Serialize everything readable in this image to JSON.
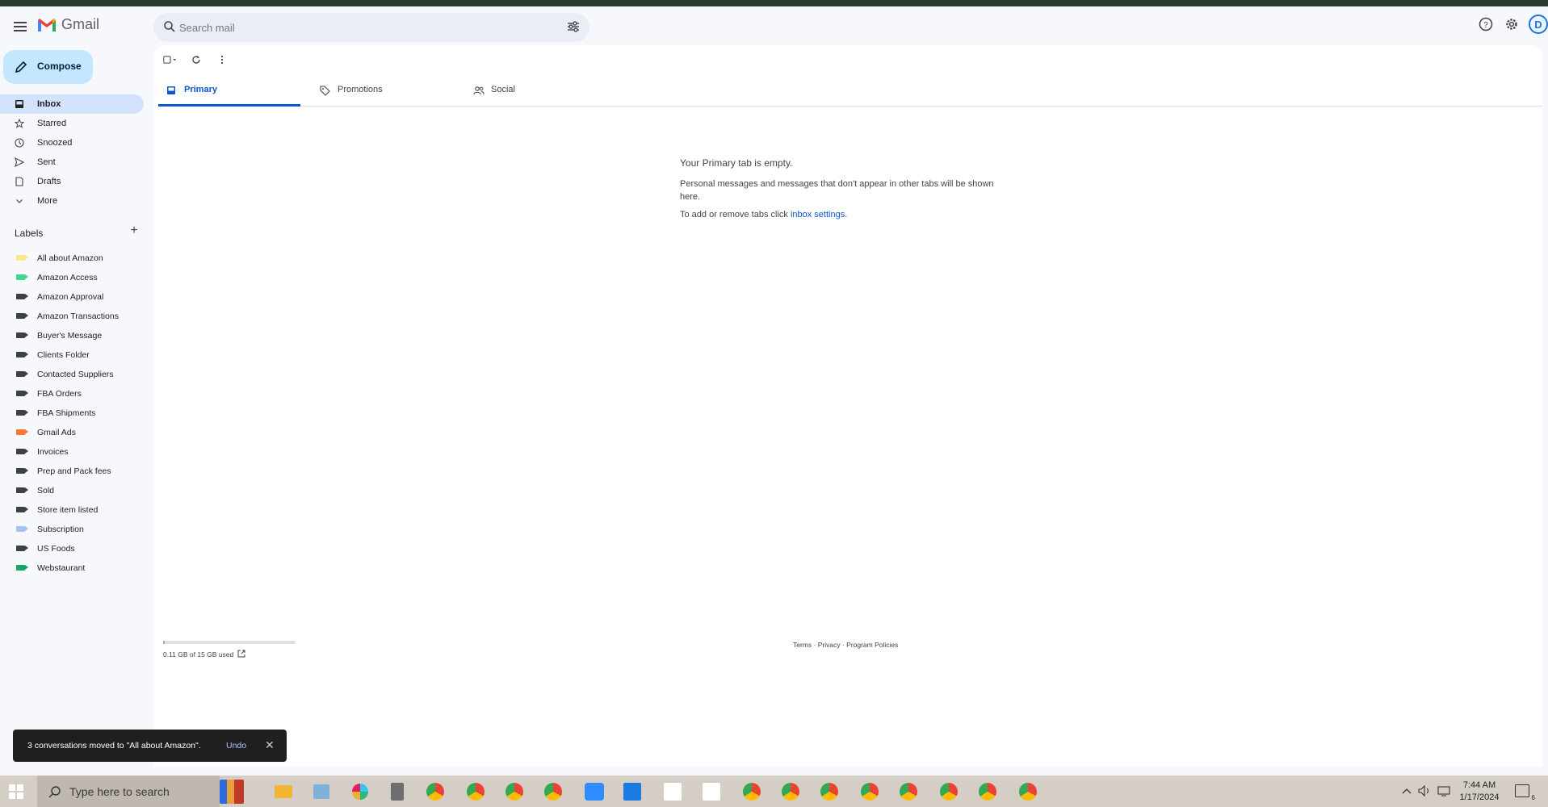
{
  "app": {
    "name": "Gmail"
  },
  "search": {
    "placeholder": "Search mail"
  },
  "header": {
    "avatar_letter": "D"
  },
  "compose": {
    "label": "Compose"
  },
  "nav": [
    {
      "label": "Inbox",
      "icon": "inbox-icon",
      "active": true
    },
    {
      "label": "Starred",
      "icon": "star-icon"
    },
    {
      "label": "Snoozed",
      "icon": "clock-icon"
    },
    {
      "label": "Sent",
      "icon": "send-icon"
    },
    {
      "label": "Drafts",
      "icon": "draft-icon"
    },
    {
      "label": "More",
      "icon": "chevron-down-icon"
    }
  ],
  "labels": {
    "title": "Labels",
    "items": [
      {
        "label": "All about Amazon",
        "color": "#fce68b"
      },
      {
        "label": "Amazon Access",
        "color": "#43d692"
      },
      {
        "label": "Amazon Approval",
        "color": "#3c4043"
      },
      {
        "label": "Amazon Transactions",
        "color": "#3c4043"
      },
      {
        "label": "Buyer's Message",
        "color": "#3c4043"
      },
      {
        "label": "Clients Folder",
        "color": "#3c4043"
      },
      {
        "label": "Contacted Suppliers",
        "color": "#3c4043"
      },
      {
        "label": "FBA Orders",
        "color": "#3c4043"
      },
      {
        "label": "FBA Shipments",
        "color": "#3c4043"
      },
      {
        "label": "Gmail Ads",
        "color": "#ff7537"
      },
      {
        "label": "Invoices",
        "color": "#3c4043"
      },
      {
        "label": "Prep and Pack fees",
        "color": "#3c4043"
      },
      {
        "label": "Sold",
        "color": "#3c4043"
      },
      {
        "label": "Store item listed",
        "color": "#3c4043"
      },
      {
        "label": "Subscription",
        "color": "#a4c2f4"
      },
      {
        "label": "US Foods",
        "color": "#3c4043"
      },
      {
        "label": "Webstaurant",
        "color": "#16a766"
      }
    ]
  },
  "tabs": [
    {
      "label": "Primary",
      "icon": "inbox-icon",
      "active": true
    },
    {
      "label": "Promotions",
      "icon": "tag-icon"
    },
    {
      "label": "Social",
      "icon": "people-icon"
    }
  ],
  "empty": {
    "title": "Your Primary tab is empty.",
    "body": "Personal messages and messages that don't appear in other tabs will be shown here.",
    "settings_prefix": "To add or remove tabs click ",
    "settings_link": "inbox settings",
    "settings_suffix": "."
  },
  "storage": {
    "text": "0.11 GB of 15 GB used",
    "used_fraction": 0.007
  },
  "footer": {
    "terms": "Terms",
    "privacy": "Privacy",
    "policies": "Program Policies",
    "sep": " · "
  },
  "toast": {
    "message": "3 conversations moved to \"All about Amazon\".",
    "undo": "Undo"
  },
  "taskbar": {
    "search_placeholder": "Type here to search",
    "time": "7:44 AM",
    "date": "1/17/2024",
    "notification_count": "6"
  }
}
